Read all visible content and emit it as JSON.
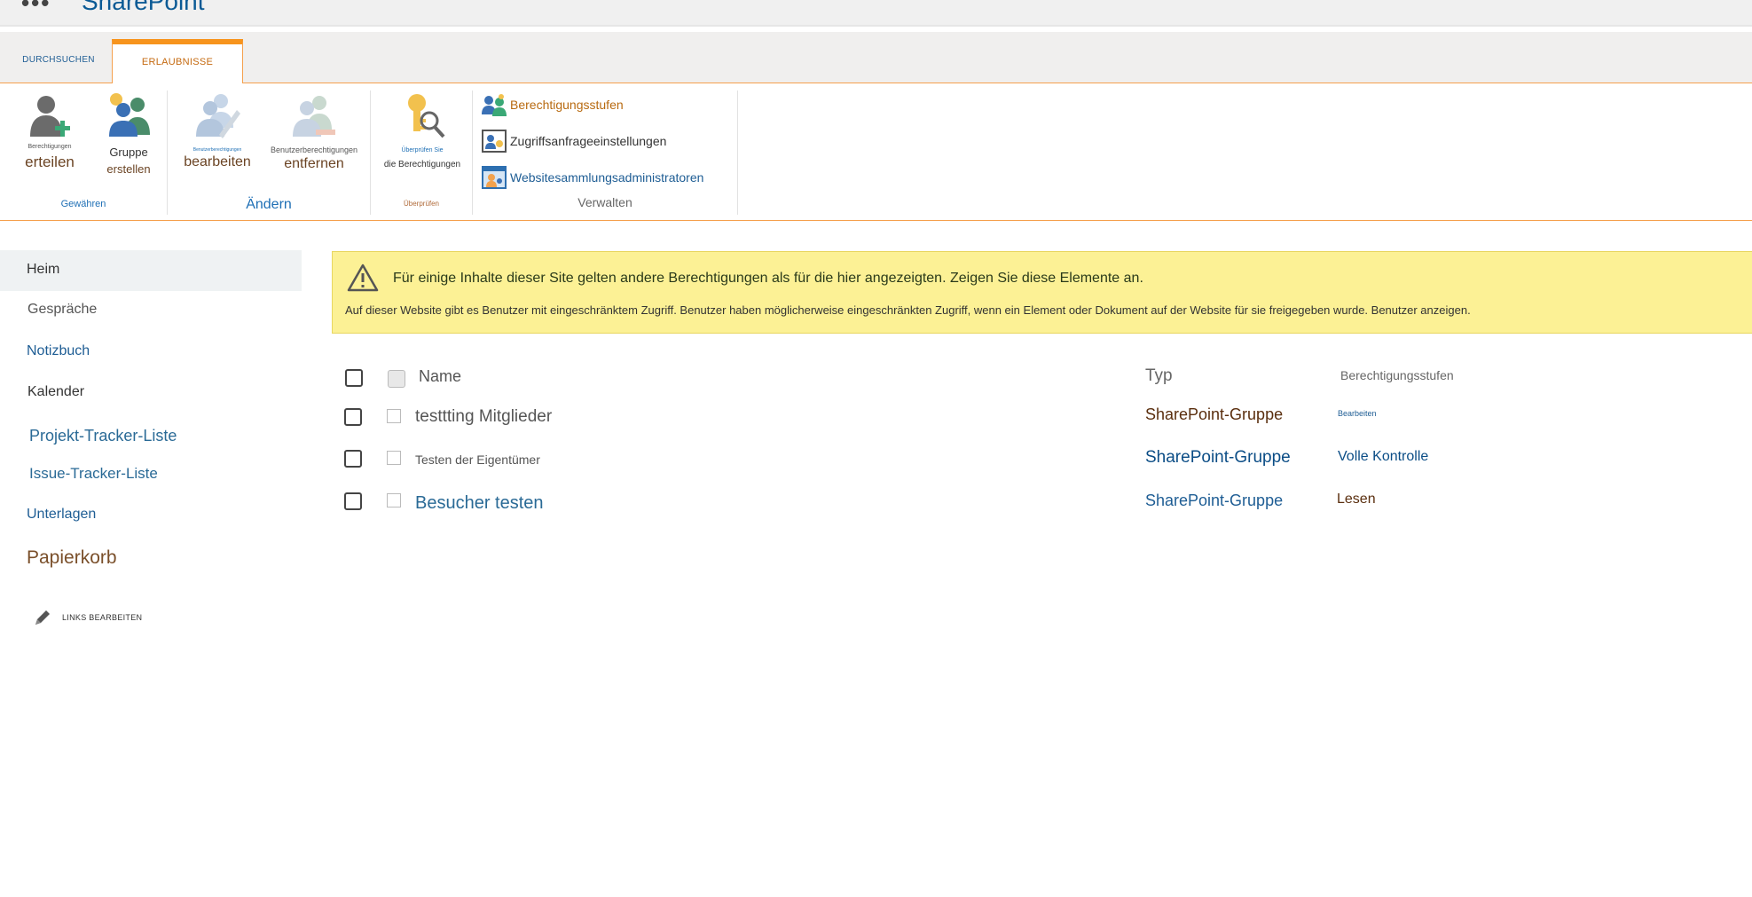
{
  "suite": {
    "waffle": "•••",
    "brand": "SharePoint"
  },
  "tabs": {
    "browse": "DURCHSUCHEN",
    "permissions": "ERLAUBNISSE"
  },
  "ribbon": {
    "grant": {
      "grant_caption": "Berechtigungen",
      "grant_label": "erteilen",
      "create_group_line1": "Gruppe",
      "create_group_line2": "erstellen",
      "group_label": "Gewähren"
    },
    "modify": {
      "edit_caption": "Benutzerberechtigungen",
      "edit_label": "bearbeiten",
      "remove_caption": "Benutzerberechtigungen",
      "remove_label": "entfernen",
      "group_label": "Ändern"
    },
    "check": {
      "caption": "Überprüfen Sie",
      "label": "die Berechtigungen",
      "group_label": "Überprüfen"
    },
    "manage": {
      "levels": "Berechtigungsstufen",
      "access_requests": "Zugriffsanfrageeinstellungen",
      "site_admins": "Websitesammlungsadministratoren",
      "group_label": "Verwalten"
    }
  },
  "nav": {
    "home": "Heim",
    "conversations": "Gespräche",
    "notebook": "Notizbuch",
    "calendar": "Kalender",
    "project_tracker": "Projekt-Tracker-Liste",
    "issue_tracker": "Issue-Tracker-Liste",
    "documents": "Unterlagen",
    "recycle_bin": "Papierkorb",
    "edit_links": "LINKS BEARBEITEN"
  },
  "banner": {
    "title": "Für einige Inhalte dieser Site gelten andere Berechtigungen als für die hier angezeigten. Zeigen Sie diese Elemente an.",
    "text": "Auf dieser Website gibt es Benutzer mit eingeschränktem Zugriff. Benutzer haben möglicherweise eingeschränkten Zugriff, wenn ein Element oder Dokument auf der Website für sie freigegeben wurde. Benutzer anzeigen."
  },
  "table": {
    "headers": {
      "name": "Name",
      "type": "Typ",
      "levels": "Berechtigungsstufen"
    },
    "rows": [
      {
        "name": "testtting Mitglieder",
        "type": "SharePoint-Gruppe",
        "level": "Bearbeiten"
      },
      {
        "name": "Testen der Eigentümer",
        "type": "SharePoint-Gruppe",
        "level": "Volle Kontrolle"
      },
      {
        "name": "Besucher testen",
        "type": "SharePoint-Gruppe",
        "level": "Lesen"
      }
    ]
  },
  "colors": {
    "accent": "#f7941d",
    "link": "#1e5d94",
    "banner": "#fcf195"
  }
}
